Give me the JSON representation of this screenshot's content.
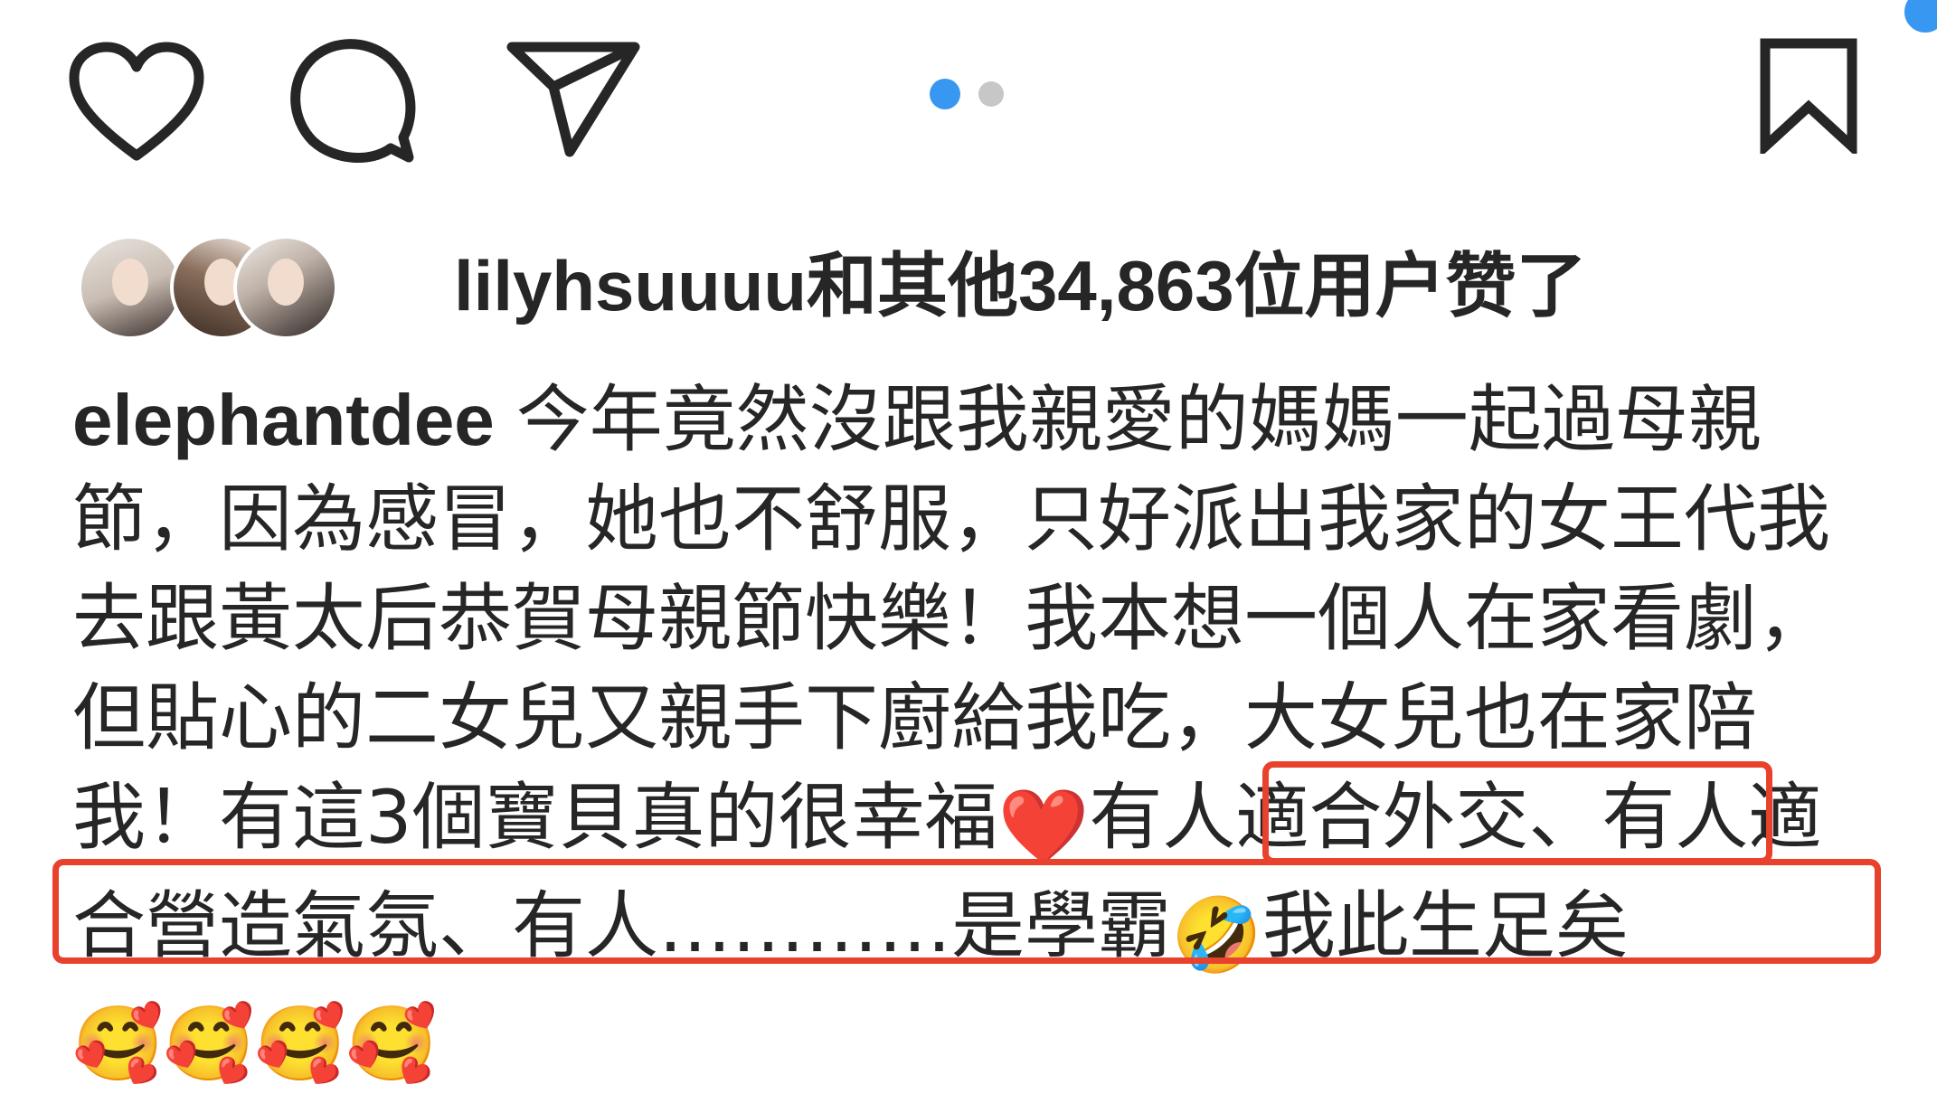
{
  "actions": {
    "like_icon": "heart-icon",
    "comment_icon": "comment-bubble-icon",
    "share_icon": "paper-plane-icon",
    "save_icon": "bookmark-icon"
  },
  "carousel": {
    "total": 2,
    "active_index": 0,
    "active_color": "#3897f0",
    "inactive_color": "#c7c7c7"
  },
  "likes": {
    "username": "lilyhsuuuu",
    "connector": "和其他",
    "count": "34,863",
    "suffix": "位用户赞了"
  },
  "caption": {
    "username": "elephantdee",
    "part1": "今年竟然沒跟我親愛的媽媽一起過母親節，因為感冒，她也不舒服，只好派出我家的女王代我去跟黃太后恭賀母親節快樂！我本想一個人在家看劇，但貼心的二女兒又親手下廚給我吃，大女兒也在家陪我！有這3個寶貝真的很幸福",
    "heart_emoji": "❤️",
    "part2": "有人適合外交、有人適合營造氣氛、有人…………是學霸",
    "laugh_emoji": "🤣",
    "part3": "我此生足矣",
    "hug_emoji": "🥰🥰🥰🥰"
  },
  "highlight_color": "#e8412c"
}
